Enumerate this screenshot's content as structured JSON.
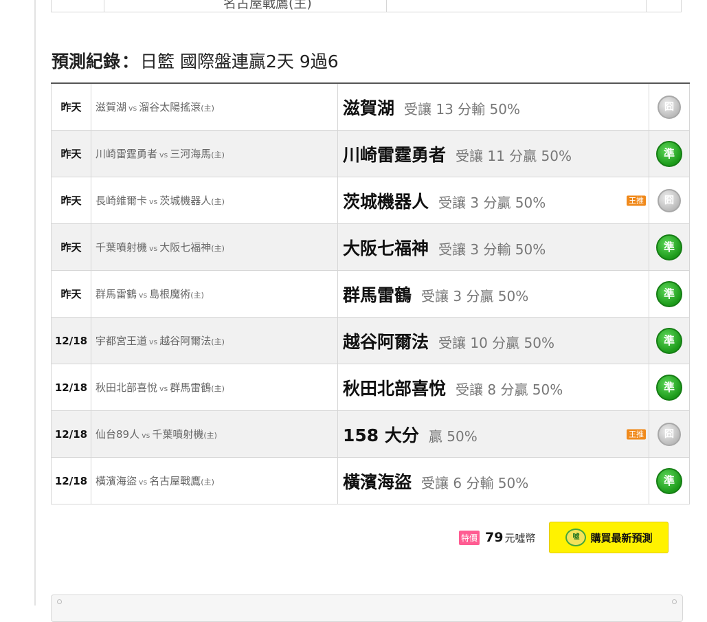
{
  "prev_row": {
    "text": "名古屋戰鷹(主)"
  },
  "heading": {
    "label": "預測紀錄",
    "sep": "：",
    "detail": "日籃 國際盤連贏2天 9過6"
  },
  "records": [
    {
      "date": "昨天",
      "away": "滋賀湖",
      "vs": "vs",
      "home": "溜谷太陽搖滾",
      "home_tag": "(主)",
      "pick": "滋賀湖",
      "odds": "受讓 13 分輸 50%",
      "king": false,
      "result": "miss",
      "result_label": "囧"
    },
    {
      "date": "昨天",
      "away": "川崎雷霆勇者",
      "vs": "vs",
      "home": "三河海馬",
      "home_tag": "(主)",
      "pick": "川崎雷霆勇者",
      "odds": "受讓 11 分贏 50%",
      "king": false,
      "result": "hit",
      "result_label": "準"
    },
    {
      "date": "昨天",
      "away": "長崎維爾卡",
      "vs": "vs",
      "home": "茨城機器人",
      "home_tag": "(主)",
      "pick": "茨城機器人",
      "odds": "受讓 3 分贏 50%",
      "king": true,
      "result": "miss",
      "result_label": "囧"
    },
    {
      "date": "昨天",
      "away": "千葉噴射機",
      "vs": "vs",
      "home": "大阪七福神",
      "home_tag": "(主)",
      "pick": "大阪七福神",
      "odds": "受讓 3 分輸 50%",
      "king": false,
      "result": "hit",
      "result_label": "準"
    },
    {
      "date": "昨天",
      "away": "群馬雷鶴",
      "vs": "vs",
      "home": "島根魔術",
      "home_tag": "(主)",
      "pick": "群馬雷鶴",
      "odds": "受讓 3 分贏 50%",
      "king": false,
      "result": "hit",
      "result_label": "準"
    },
    {
      "date": "12/18",
      "away": "宇都宮王道",
      "vs": "vs",
      "home": "越谷阿爾法",
      "home_tag": "(主)",
      "pick": "越谷阿爾法",
      "odds": "受讓 10 分贏 50%",
      "king": false,
      "result": "hit",
      "result_label": "準"
    },
    {
      "date": "12/18",
      "away": "秋田北部喜悅",
      "vs": "vs",
      "home": "群馬雷鶴",
      "home_tag": "(主)",
      "pick": "秋田北部喜悅",
      "odds": "受讓 8 分贏 50%",
      "king": false,
      "result": "hit",
      "result_label": "準"
    },
    {
      "date": "12/18",
      "away": "仙台89人",
      "vs": "vs",
      "home": "千葉噴射機",
      "home_tag": "(主)",
      "pick": "158 大分",
      "odds": "贏 50%",
      "king": true,
      "result": "miss",
      "result_label": "囧"
    },
    {
      "date": "12/18",
      "away": "橫濱海盜",
      "vs": "vs",
      "home": "名古屋戰鷹",
      "home_tag": "(主)",
      "pick": "橫濱海盜",
      "odds": "受讓 6 分輸 50%",
      "king": false,
      "result": "hit",
      "result_label": "準"
    }
  ],
  "king_label": "王推",
  "purchase": {
    "special_tag": "特價",
    "price": "79",
    "unit": "元噓幣",
    "coin_icon": "噓",
    "button_label": "購買最新預測"
  },
  "colors": {
    "hit": "#1c9a1a",
    "miss": "#b8b8b8",
    "king": "#f08a1c",
    "special": "#ff5c92",
    "button": "#fff200"
  }
}
